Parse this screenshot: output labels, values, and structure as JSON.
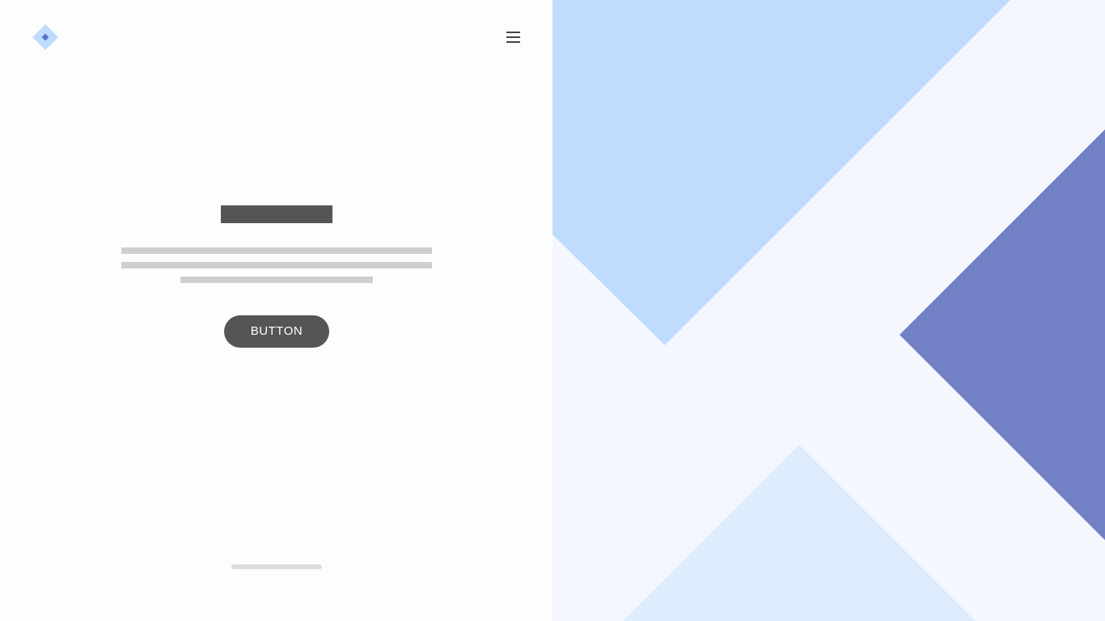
{
  "header": {
    "logo_icon": "diamond-logo-icon",
    "menu_icon": "hamburger-menu-icon"
  },
  "hero": {
    "cta_label": "BUTTON"
  },
  "colors": {
    "background": "#fdfdfd",
    "title_placeholder": "#555555",
    "text_placeholder": "#cfcfcf",
    "button_bg": "#555555",
    "button_text": "#ffffff",
    "logo_light": "#bfdcff",
    "logo_dark": "#7f8fd6",
    "art_background": "#f4f8fe",
    "art_light_blue": "#bfdcff",
    "art_indigo": "#7280c6",
    "art_pale_blue": "#ddecfd"
  }
}
